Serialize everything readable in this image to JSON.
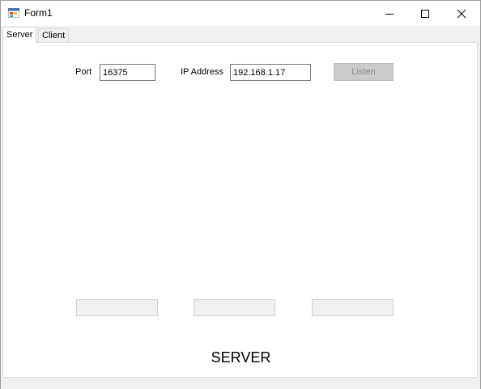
{
  "window": {
    "title": "Form1",
    "icons": {
      "app": "form-app-icon",
      "minimize": "minimize-icon",
      "maximize": "maximize-icon",
      "close": "close-icon"
    }
  },
  "tabs": [
    {
      "label": "Server",
      "selected": true
    },
    {
      "label": "Client",
      "selected": false
    }
  ],
  "server": {
    "port_label": "Port",
    "port_value": "16375",
    "ip_label": "IP Address",
    "ip_value": "192.168.1.17",
    "listen_label": "Listen",
    "heading": "SERVER"
  }
}
